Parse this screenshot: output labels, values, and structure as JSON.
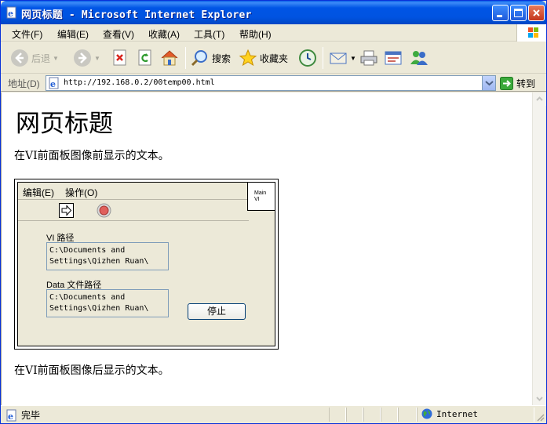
{
  "window": {
    "title": "网页标题 - Microsoft Internet Explorer",
    "icon": "ie-page-icon",
    "controls": [
      "minimize",
      "maximize",
      "close"
    ]
  },
  "menubar": {
    "items": [
      "文件(F)",
      "编辑(E)",
      "查看(V)",
      "收藏(A)",
      "工具(T)",
      "帮助(H)"
    ]
  },
  "toolbar": {
    "back_label": "后退",
    "search_label": "搜索",
    "favorites_label": "收藏夹"
  },
  "address": {
    "label": "地址(D)",
    "url": "http://192.168.0.2/00temp00.html",
    "go_label": "转到"
  },
  "page": {
    "heading": "网页标题",
    "text_before": "在VI前面板图像前显示的文本。",
    "text_after": "在VI前面板图像后显示的文本。"
  },
  "vi_panel": {
    "menu": [
      "编辑(E)",
      "操作(O)"
    ],
    "icon_label_line1": "Main",
    "icon_label_line2": "VI",
    "vi_path_label": "VI 路径",
    "vi_path_line1": "C:\\Documents and",
    "vi_path_line2": "Settings\\Qizhen Ruan\\",
    "data_path_label": "Data 文件路径",
    "data_path_line1": "C:\\Documents and",
    "data_path_line2": "Settings\\Qizhen Ruan\\",
    "stop_label": "停止"
  },
  "status": {
    "left_text": "完毕",
    "zone_text": "Internet"
  },
  "colors": {
    "title_bar": "#0053E1",
    "chrome": "#ECE9D8",
    "link_blue": "#0831D9"
  }
}
